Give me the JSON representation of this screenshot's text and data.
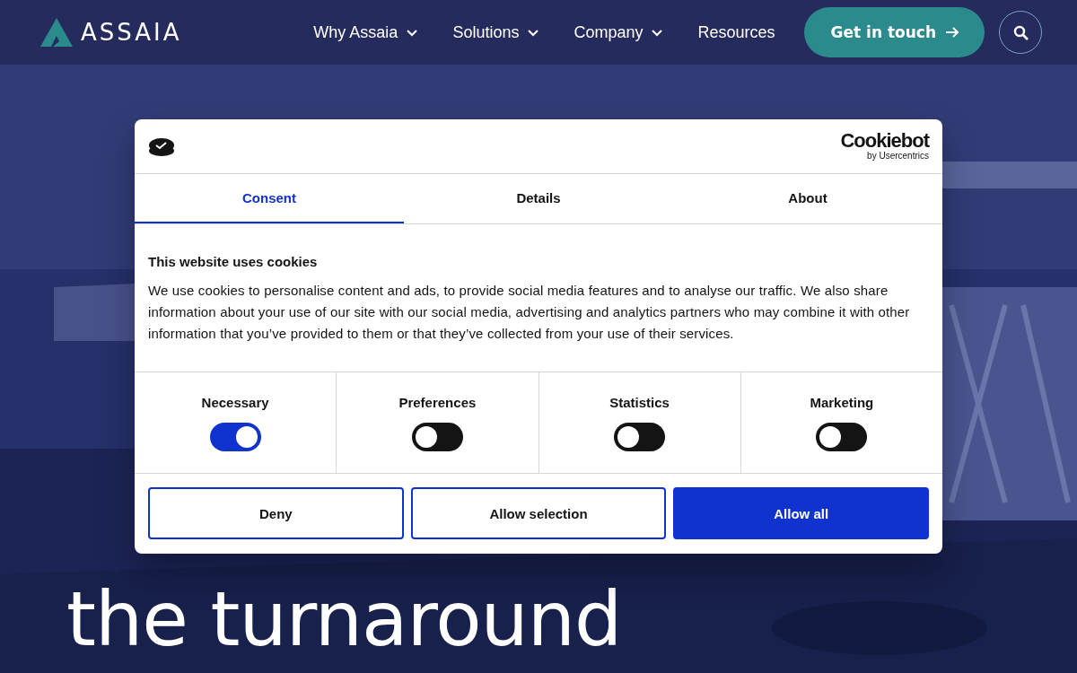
{
  "header": {
    "logo": "ASSAIA",
    "nav": [
      {
        "label": "Why Assaia",
        "dropdown": true
      },
      {
        "label": "Solutions",
        "dropdown": true
      },
      {
        "label": "Company",
        "dropdown": true
      },
      {
        "label": "Resources",
        "dropdown": false
      }
    ],
    "cta": "Get in touch"
  },
  "hero": {
    "kind": "picture",
    "headline": [
      "the turnaround"
    ]
  },
  "dialog": {
    "brand": "Cookiebot",
    "brand_sub": "by Usercentrics",
    "tabs": [
      {
        "label": "Consent",
        "selected": true
      },
      {
        "label": "Details",
        "selected": false
      },
      {
        "label": "About",
        "selected": false
      }
    ],
    "title": "This website uses cookies",
    "body": "We use cookies to personalise content and ads, to provide social media features and to analyse our traffic. We also share information about your use of our site with our social media, advertising and analytics partners who may combine it with other information that you’ve provided to them or that they’ve collected from your use of their services.",
    "categories": [
      {
        "label": "Necessary",
        "checked": true
      },
      {
        "label": "Preferences",
        "checked": false
      },
      {
        "label": "Statistics",
        "checked": false
      },
      {
        "label": "Marketing",
        "checked": false
      }
    ],
    "buttons": [
      {
        "label": "Deny",
        "kind": "outline"
      },
      {
        "label": "Allow selection",
        "kind": "outline"
      },
      {
        "label": "Allow all",
        "kind": "primary"
      }
    ]
  }
}
